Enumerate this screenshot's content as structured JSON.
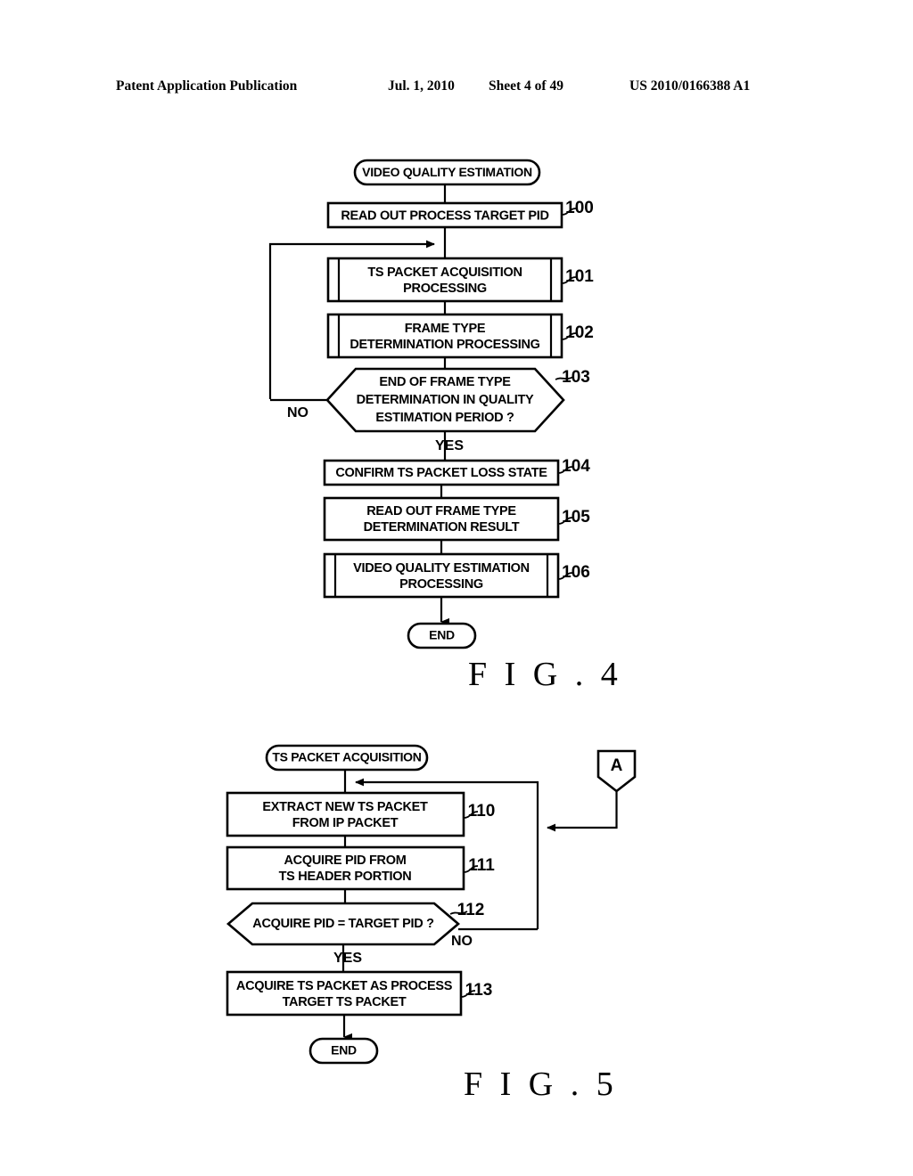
{
  "header": {
    "publication": "Patent Application Publication",
    "date": "Jul. 1, 2010",
    "sheet": "Sheet 4 of 49",
    "number": "US 2010/0166388 A1"
  },
  "figures": [
    {
      "caption": "F I G . 4",
      "start_label": "VIDEO QUALITY ESTIMATION",
      "end_label": "END",
      "steps": [
        {
          "ref": "100",
          "type": "process",
          "lines": [
            "READ OUT PROCESS TARGET PID"
          ]
        },
        {
          "ref": "101",
          "type": "predefined",
          "lines": [
            "TS PACKET ACQUISITION",
            "PROCESSING"
          ]
        },
        {
          "ref": "102",
          "type": "predefined",
          "lines": [
            "FRAME TYPE",
            "DETERMINATION PROCESSING"
          ]
        },
        {
          "ref": "103",
          "type": "decision",
          "lines": [
            "END OF FRAME TYPE",
            "DETERMINATION IN QUALITY",
            "ESTIMATION PERIOD ?"
          ]
        },
        {
          "ref": "104",
          "type": "process",
          "lines": [
            "CONFIRM TS PACKET LOSS STATE"
          ]
        },
        {
          "ref": "105",
          "type": "process",
          "lines": [
            "READ OUT FRAME TYPE",
            "DETERMINATION RESULT"
          ]
        },
        {
          "ref": "106",
          "type": "predefined",
          "lines": [
            "VIDEO QUALITY ESTIMATION",
            "PROCESSING"
          ]
        }
      ],
      "branch_labels": {
        "no": "NO",
        "yes": "YES"
      }
    },
    {
      "caption": "F I G . 5",
      "start_label": "TS PACKET ACQUISITION",
      "end_label": "END",
      "connector_label": "A",
      "steps": [
        {
          "ref": "110",
          "type": "process",
          "lines": [
            "EXTRACT NEW TS PACKET",
            "FROM IP PACKET"
          ]
        },
        {
          "ref": "111",
          "type": "process",
          "lines": [
            "ACQUIRE PID FROM",
            "TS HEADER PORTION"
          ]
        },
        {
          "ref": "112",
          "type": "decision",
          "lines": [
            "ACQUIRE PID = TARGET PID ?"
          ]
        },
        {
          "ref": "113",
          "type": "process",
          "lines": [
            "ACQUIRE TS PACKET AS PROCESS",
            "TARGET TS PACKET"
          ]
        }
      ],
      "branch_labels": {
        "no": "NO",
        "yes": "YES"
      }
    }
  ],
  "colors": {
    "ink": "#000000",
    "paper": "#ffffff"
  }
}
